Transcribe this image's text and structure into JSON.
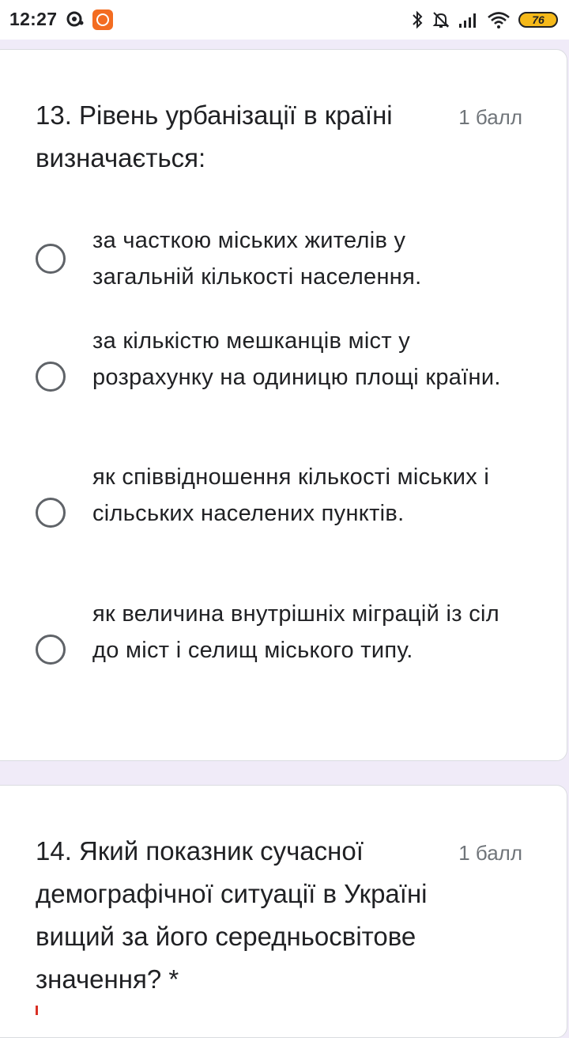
{
  "status_bar": {
    "time": "12:27",
    "battery": "76",
    "icons": [
      "camera-lens-icon",
      "mi-app-icon",
      "bluetooth-icon",
      "bell-muted-icon",
      "signal-icon",
      "wifi-icon",
      "battery-icon"
    ]
  },
  "questions": [
    {
      "title": "13. Рівень урбанізації в країні визначається:",
      "points": "1 балл",
      "options": [
        "за часткою міських жителів у загальній кількості населення.",
        "за кількістю мешканців міст у розрахунку на одиницю площі країни.",
        "як співвідношення кількості міських і сільських населених пунктів.",
        "як величина внутрішніх міграцій із сіл до міст і селищ міського типу."
      ]
    },
    {
      "title": "14. Який показник сучасної демографічної ситуації в Україні вищий за його середньосвітове значення? *",
      "points": "1 балл"
    }
  ],
  "colors": {
    "page_background": "#f0ebf8",
    "card": "#ffffff",
    "radio_border": "#5f6368",
    "points_text": "#70757a",
    "required": "#d93025"
  }
}
